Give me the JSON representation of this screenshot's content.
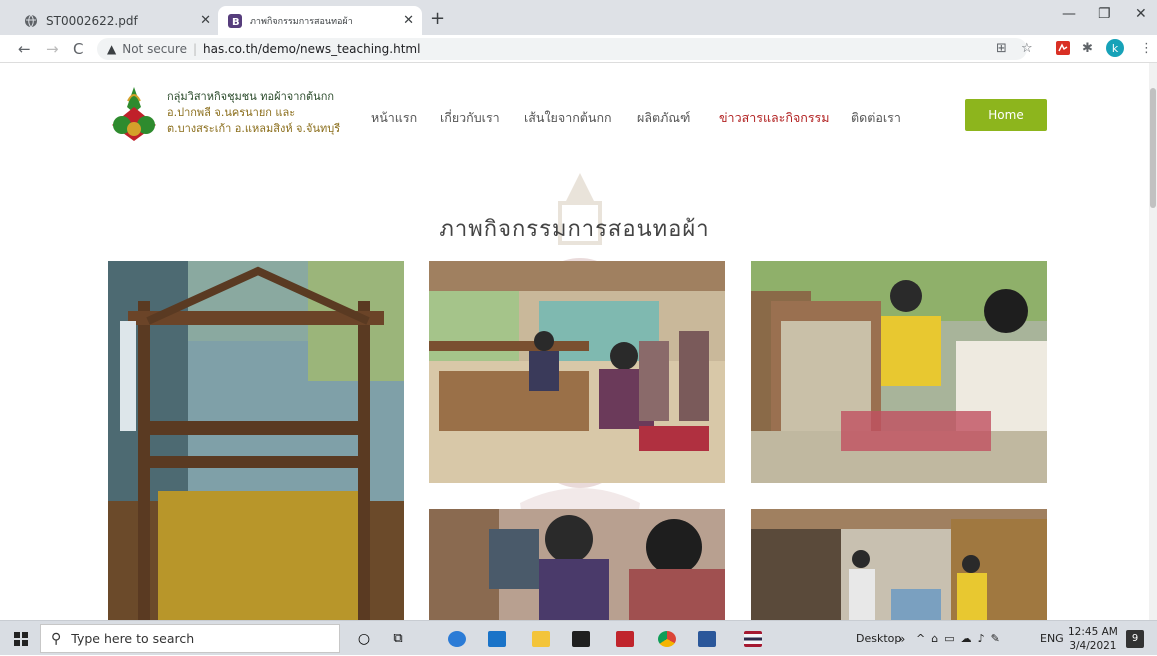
{
  "tabs": [
    {
      "title": "ST0002622.pdf",
      "icon": "globe-icon"
    },
    {
      "title": "ภาพกิจกรรมการสอนทอผ้า",
      "icon": "bootstrap-icon"
    }
  ],
  "address": {
    "security": "Not secure",
    "url": "has.co.th/demo/news_teaching.html"
  },
  "profile_initial": "k",
  "site": {
    "brand": [
      "กลุ่มวิสาหกิจชุมชน ทอผ้าจากต้นกก",
      "อ.ปากพลี จ.นครนายก และ",
      "ต.บางสระเก้า อ.แหลมสิงห์ จ.จันทบุรี"
    ],
    "menu": [
      "หน้าแรก",
      "เกี่ยวกับเรา",
      "เส้นใยจากต้นกก",
      "ผลิตภัณฑ์",
      "ข่าวสารและกิจกรรม",
      "ติดต่อเรา"
    ],
    "active_menu": "ข่าวสารและกิจกรรม",
    "home_button": "Home",
    "page_title": "ภาพกิจกรรมการสอนทอผ้า",
    "accent": "#8db51d"
  },
  "taskbar": {
    "search_placeholder": "Type here to search",
    "desktop": "Desktop",
    "lang": "ENG",
    "time": "12:45 AM",
    "date": "3/4/2021",
    "notifications": "9"
  }
}
